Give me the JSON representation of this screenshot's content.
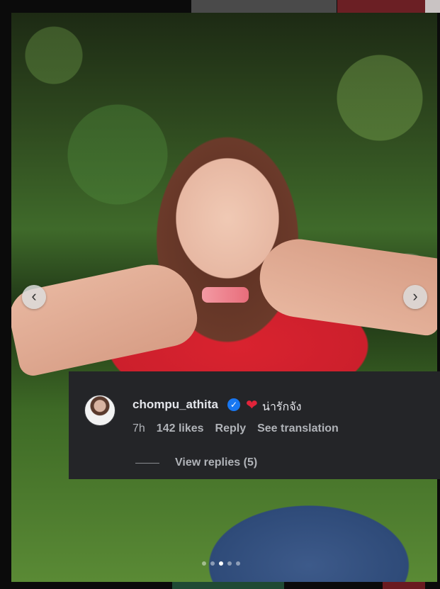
{
  "carousel": {
    "prev_symbol": "‹",
    "next_symbol": "›",
    "dots_total": 5,
    "active_dot": 2
  },
  "comment": {
    "author": "chompu_athita",
    "verified_symbol": "✓",
    "heart_symbol": "❤",
    "text": "น่ารักจัง",
    "time": "7h",
    "likes": "142 likes",
    "reply_label": "Reply",
    "translate_label": "See translation",
    "view_replies": "View replies (5)"
  },
  "colors": {
    "panel_bg": "#242528",
    "verified_blue": "#1877f2",
    "heart_red": "#e0243a",
    "dress_red": "#d9232f"
  },
  "icons": {
    "verified": "verified-badge-icon",
    "heart": "red-heart-icon",
    "prev": "chevron-left-icon",
    "next": "chevron-right-icon"
  }
}
